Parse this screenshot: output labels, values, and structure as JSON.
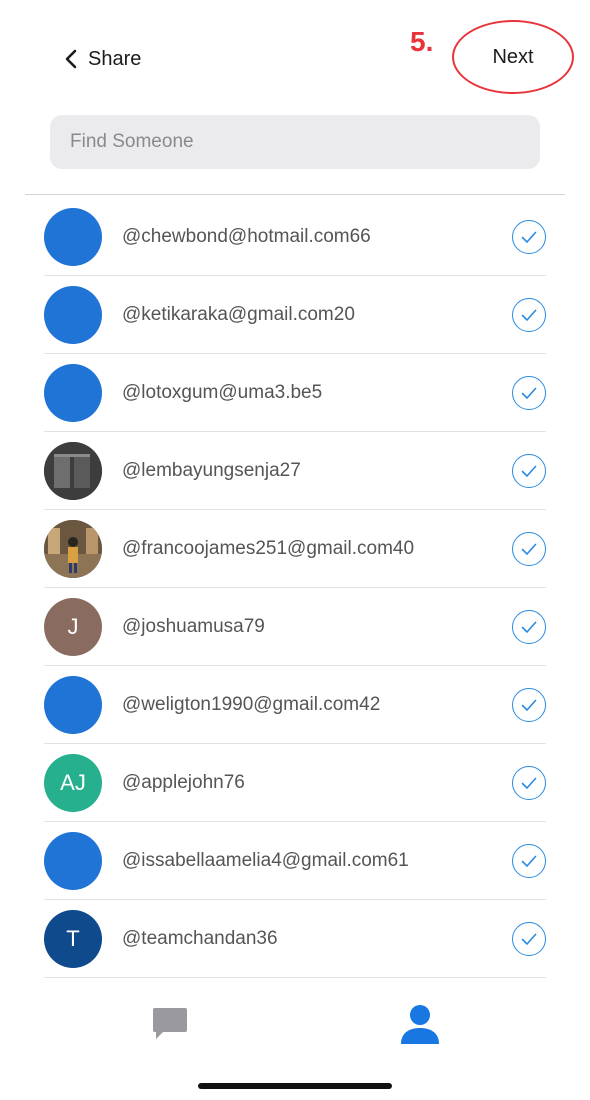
{
  "header": {
    "back_label": "Share",
    "step_marker": "5.",
    "next_label": "Next"
  },
  "search": {
    "placeholder": "Find Someone"
  },
  "contacts": [
    {
      "handle": "@chewbond@hotmail.com66",
      "avatar": "plain",
      "color": "#1f74d6"
    },
    {
      "handle": "@ketikaraka@gmail.com20",
      "avatar": "plain",
      "color": "#1f74d6"
    },
    {
      "handle": "@lotoxgum@uma3.be5",
      "avatar": "plain",
      "color": "#1f74d6"
    },
    {
      "handle": "@lembayungsenja27",
      "avatar": "photo",
      "color": "#4a4a4a"
    },
    {
      "handle": "@francoojames251@gmail.com40",
      "avatar": "photo",
      "color": "#7a6248"
    },
    {
      "handle": "@joshuamusa79",
      "avatar": "J",
      "color": "#8a6b5f"
    },
    {
      "handle": "@weligton1990@gmail.com42",
      "avatar": "plain",
      "color": "#1f74d6"
    },
    {
      "handle": "@applejohn76",
      "avatar": "AJ",
      "color": "#26b08d"
    },
    {
      "handle": "@issabellaamelia4@gmail.com61",
      "avatar": "plain",
      "color": "#1f74d6"
    },
    {
      "handle": "@teamchandan36",
      "avatar": "T",
      "color": "#0f4a8c"
    }
  ],
  "tabs": [
    {
      "icon": "chat-bubble-icon",
      "active": false,
      "color": "#9a9a9e"
    },
    {
      "icon": "person-icon",
      "active": true,
      "color": "#1877e0"
    }
  ],
  "colors": {
    "accent": "#2a8be0",
    "annotation": "#e8333a"
  }
}
